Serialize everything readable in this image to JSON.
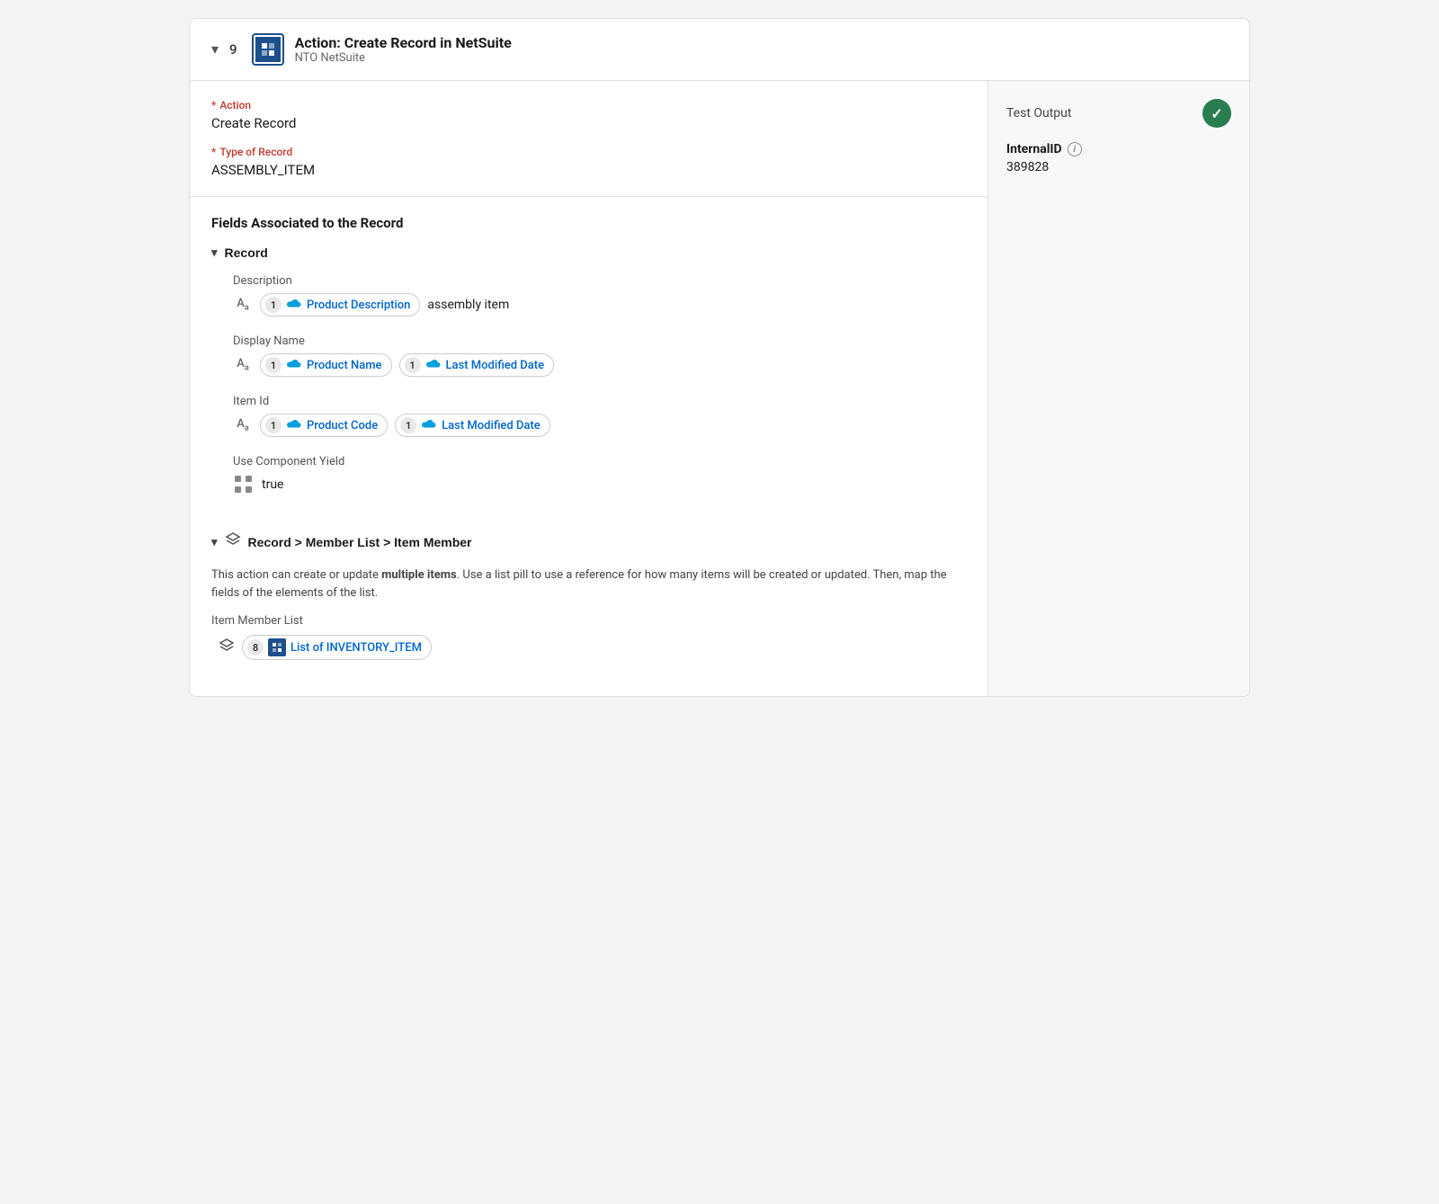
{
  "header": {
    "chevron": "▾",
    "step_number": "9",
    "title": "Action: Create Record in NetSuite",
    "subtitle": "NTO NetSuite",
    "logo_text": "N"
  },
  "action_section": {
    "action_label": "Action",
    "action_value": "Create Record",
    "type_label": "Type of Record",
    "type_value": "ASSEMBLY_ITEM"
  },
  "fields_section": {
    "title": "Fields Associated to the Record",
    "record_group": {
      "label": "Record",
      "fields": [
        {
          "name": "description",
          "label": "Description",
          "type_icon": "Aa",
          "pills": [
            {
              "number": "1",
              "text": "Product Description"
            }
          ],
          "plain_text": "assembly item"
        },
        {
          "name": "display_name",
          "label": "Display Name",
          "type_icon": "Aa",
          "pills": [
            {
              "number": "1",
              "text": "Product Name"
            },
            {
              "number": "1",
              "text": "Last Modified Date"
            }
          ],
          "plain_text": ""
        },
        {
          "name": "item_id",
          "label": "Item Id",
          "type_icon": "Aa",
          "pills": [
            {
              "number": "1",
              "text": "Product Code"
            },
            {
              "number": "1",
              "text": "Last Modified Date"
            }
          ],
          "plain_text": ""
        },
        {
          "name": "use_component_yield",
          "label": "Use Component Yield",
          "type_icon": "bool",
          "pills": [],
          "plain_text": "true"
        }
      ]
    },
    "member_group": {
      "label": "Record > Member List > Item Member",
      "info_text_part1": "This action can create or update ",
      "info_text_bold": "multiple items",
      "info_text_part2": ". Use a list pill to use a reference for how many items will be created or updated. Then, map the fields of the elements of the list.",
      "item_member_list_label": "Item Member List",
      "item_member_pill_number": "8",
      "item_member_pill_text": "List of INVENTORY_ITEM"
    }
  },
  "test_output": {
    "label": "Test Output",
    "internal_id_label": "InternalID",
    "internal_id_value": "389828"
  }
}
